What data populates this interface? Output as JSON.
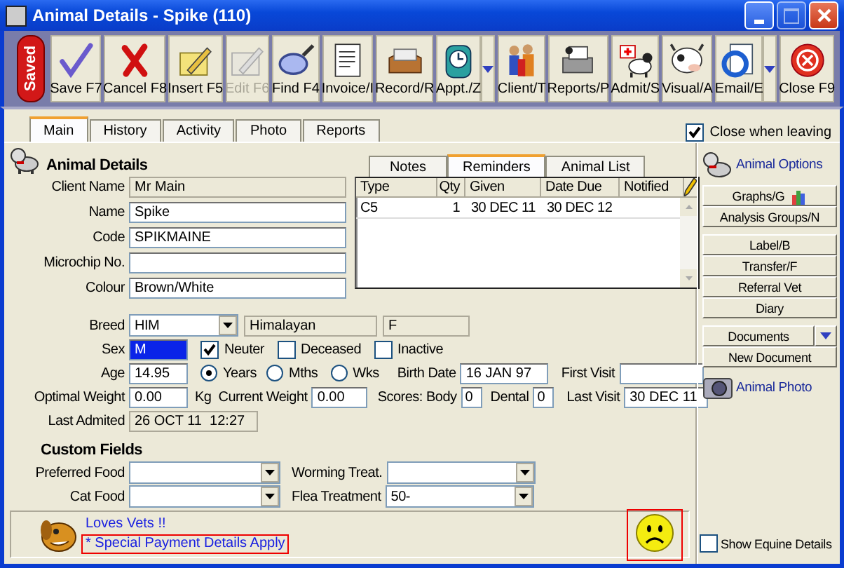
{
  "window": {
    "title": "Animal Details - Spike (110)"
  },
  "saved_badge": "Saved",
  "toolbar": [
    {
      "label": "Save F7",
      "disabled": false,
      "menu": false
    },
    {
      "label": "Cancel F8",
      "disabled": false,
      "menu": false
    },
    {
      "label": "Insert F5",
      "disabled": false,
      "menu": false
    },
    {
      "label": "Edit F6",
      "disabled": true,
      "menu": false
    },
    {
      "label": "Find F4",
      "disabled": false,
      "menu": false
    },
    {
      "label": "Invoice/I",
      "disabled": false,
      "menu": false
    },
    {
      "label": "Record/R",
      "disabled": false,
      "menu": false
    },
    {
      "label": "Appt./Z",
      "disabled": false,
      "menu": true
    },
    {
      "label": "Client/T",
      "disabled": false,
      "menu": false
    },
    {
      "label": "Reports/P",
      "disabled": false,
      "menu": false
    },
    {
      "label": "Admit/S",
      "disabled": false,
      "menu": false
    },
    {
      "label": "Visual/A",
      "disabled": false,
      "menu": false
    },
    {
      "label": "Email/E",
      "disabled": false,
      "menu": true
    },
    {
      "label": "Close F9",
      "disabled": false,
      "menu": false
    }
  ],
  "tabs": [
    {
      "label": "Main",
      "selected": true
    },
    {
      "label": "History",
      "selected": false
    },
    {
      "label": "Activity",
      "selected": false
    },
    {
      "label": "Photo",
      "selected": false
    },
    {
      "label": "Reports",
      "selected": false
    }
  ],
  "close_when_leaving": {
    "label": "Close when leaving",
    "checked": true
  },
  "animal_details": {
    "title": "Animal Details",
    "fields": [
      {
        "label": "Client Name",
        "value": "Mr Main",
        "readonly": true
      },
      {
        "label": "Name",
        "value": "Spike",
        "readonly": false
      },
      {
        "label": "Code",
        "value": "SPIKMAINE",
        "readonly": false
      },
      {
        "label": "Microchip No.",
        "readonly": false
      },
      {
        "label": "Colour",
        "value": "Brown/White",
        "readonly": false
      }
    ]
  },
  "subtabs": [
    {
      "label": "Notes",
      "selected": false
    },
    {
      "label": "Reminders",
      "selected": true
    },
    {
      "label": "Animal List",
      "selected": false
    }
  ],
  "reminders": {
    "columns": [
      "Type",
      "Qty",
      "Given",
      "Date Due",
      "Notified"
    ],
    "rows": [
      {
        "cells": [
          "C5",
          "1",
          "30 DEC 11",
          "30 DEC 12"
        ]
      }
    ]
  },
  "breed": {
    "label": "Breed",
    "code": "HIM",
    "name": "Himalayan",
    "extra": "F"
  },
  "sex": {
    "label": "Sex",
    "value": "M",
    "focused": true
  },
  "flags": [
    {
      "label": "Neuter",
      "checked": true
    },
    {
      "label": "Deceased",
      "checked": false
    },
    {
      "label": "Inactive",
      "checked": false
    }
  ],
  "age": {
    "label": "Age",
    "value": "14.95",
    "units": [
      {
        "label": "Years",
        "selected": true
      },
      {
        "label": "Mths",
        "selected": false
      },
      {
        "label": "Wks",
        "selected": false
      }
    ]
  },
  "birth_date": {
    "label": "Birth Date",
    "value": "16 JAN 97"
  },
  "first_visit": {
    "label": "First Visit"
  },
  "optimal_weight": {
    "label": "Optimal Weight",
    "value": "0.00",
    "unit": "Kg"
  },
  "current_weight": {
    "label": "Current Weight",
    "value": "0.00"
  },
  "scores_body": {
    "label": "Scores: Body",
    "value": "0"
  },
  "dental": {
    "label": "Dental",
    "value": "0"
  },
  "last_visit": {
    "label": "Last Visit",
    "value": "30 DEC 11"
  },
  "last_admitted": {
    "label": "Last Admited",
    "value": "26 OCT 11  12:27"
  },
  "custom_fields": {
    "title": "Custom Fields",
    "fields": [
      {
        "label": "Preferred Food"
      },
      {
        "label": "Cat Food"
      },
      {
        "label": "Worming Treat."
      },
      {
        "label": "Flea Treatment",
        "value": "50-"
      }
    ]
  },
  "alerts": [
    {
      "text": "Loves Vets !!",
      "highlighted": false
    },
    {
      "text": "* Special Payment Details Apply",
      "highlighted": true
    }
  ],
  "mood": {
    "kind": "sad",
    "highlighted": true
  },
  "show_equine": {
    "label": "Show Equine Details",
    "checked": false
  },
  "options": {
    "title": "Animal Options",
    "groups": [
      [
        {
          "label": "Graphs/G",
          "menu": false
        },
        {
          "label": "Analysis Groups/N",
          "menu": false
        }
      ],
      [
        {
          "label": "Label/B",
          "menu": false
        },
        {
          "label": "Transfer/F",
          "menu": false
        },
        {
          "label": "Referral Vet",
          "menu": false
        },
        {
          "label": "Diary",
          "menu": false
        }
      ],
      [
        {
          "label": "Documents",
          "menu": true
        },
        {
          "label": "New Document",
          "menu": false
        }
      ]
    ],
    "photo_link": "Animal Photo"
  }
}
